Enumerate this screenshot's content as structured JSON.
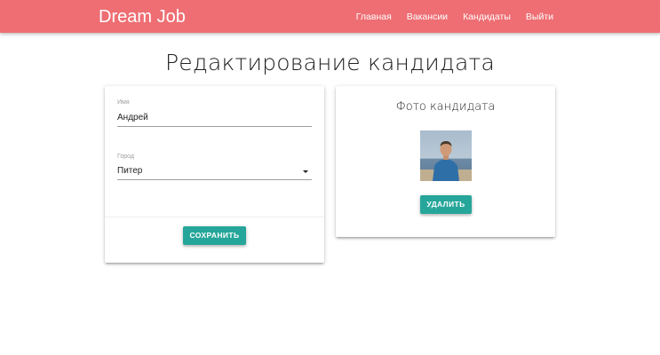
{
  "header": {
    "brand": "Dream Job",
    "nav": [
      "Главная",
      "Вакансии",
      "Кандидаты",
      "Выйти"
    ]
  },
  "page": {
    "title": "Редактирование кандидата"
  },
  "form": {
    "name_label": "Имя",
    "name_value": "Андрей",
    "city_label": "Город",
    "city_value": "Питер",
    "save_label": "СОХРАНИТЬ"
  },
  "photo_card": {
    "title": "Фото кандидата",
    "delete_label": "УДАЛИТЬ"
  },
  "colors": {
    "navbar": "#ee6e73",
    "button": "#26a69a"
  }
}
